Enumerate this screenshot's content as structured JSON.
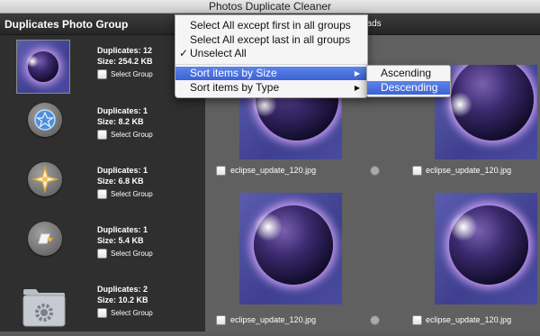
{
  "window": {
    "title": "Photos Duplicate Cleaner"
  },
  "sidebar": {
    "header": "Duplicates Photo Group",
    "select_label": "Select Group",
    "groups": [
      {
        "duplicates": "Duplicates: 12",
        "size": "Size: 254.2 KB",
        "icon": "eclipse-thumbnail"
      },
      {
        "duplicates": "Duplicates: 1",
        "size": "Size: 8.2 KB",
        "icon": "blue-star-circle-icon"
      },
      {
        "duplicates": "Duplicates: 1",
        "size": "Size: 6.8 KB",
        "icon": "gold-star-circle-icon"
      },
      {
        "duplicates": "Duplicates: 1",
        "size": "Size: 5.4 KB",
        "icon": "download-circle-icon"
      },
      {
        "duplicates": "Duplicates: 2",
        "size": "Size: 10.2 KB",
        "icon": "folder-gear-icon"
      }
    ]
  },
  "main": {
    "header_fragment": "oads",
    "cards": [
      {
        "filename": "eclipse_update_120.jpg"
      },
      {
        "filename": "eclipse_update_120.jpg"
      },
      {
        "filename": "eclipse_update_120.jpg"
      },
      {
        "filename": "eclipse_update_120.jpg"
      }
    ]
  },
  "menu": {
    "items": [
      {
        "label": "Select All except first in all groups"
      },
      {
        "label": "Select All except last in all groups"
      },
      {
        "label": "Unselect All",
        "checked": true,
        "check_mark": "✓"
      },
      {
        "label": "Sort items by Size",
        "highlighted": true,
        "submenu_arrow": "▶"
      },
      {
        "label": "Sort items by Type",
        "submenu_arrow": "▶"
      }
    ],
    "submenu": [
      {
        "label": "Ascending"
      },
      {
        "label": "Descending",
        "highlighted": true
      }
    ]
  }
}
